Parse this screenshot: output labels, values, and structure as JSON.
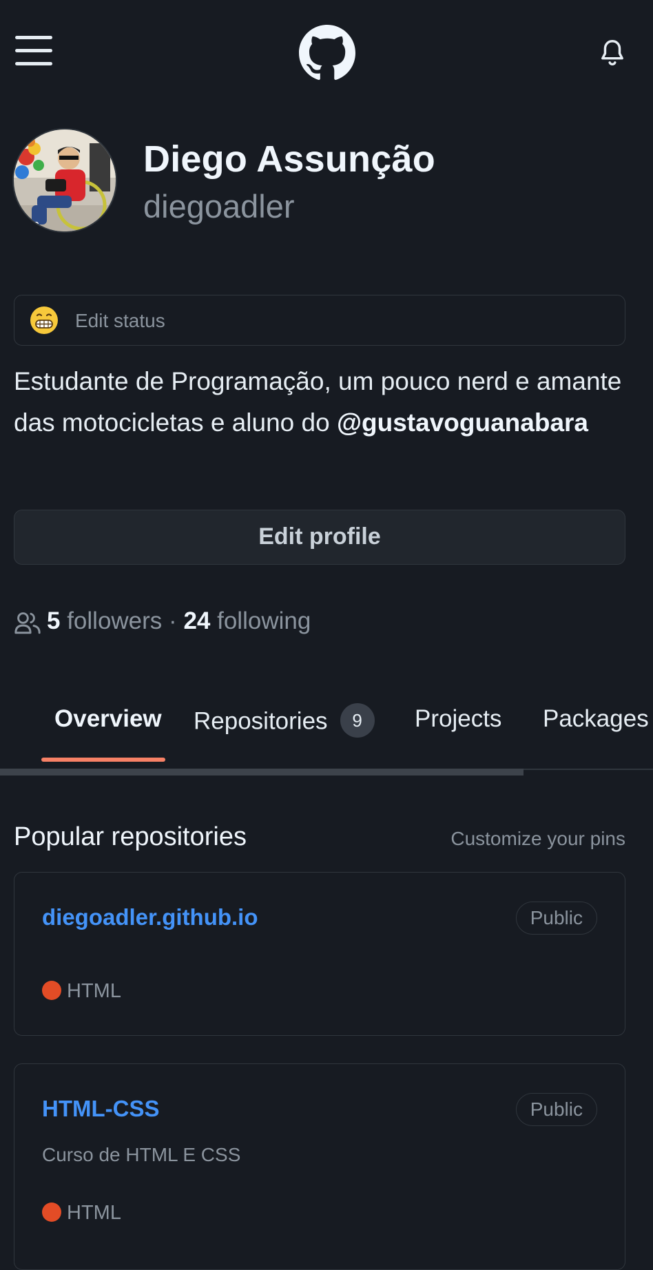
{
  "header": {
    "menu_icon": "hamburger-menu-icon",
    "logo_icon": "github-octocat-icon",
    "notifications_icon": "bell-icon"
  },
  "profile": {
    "name": "Diego Assunção",
    "login": "diegoadler",
    "status_emoji": "grinning-face-icon",
    "status_text": "Edit status",
    "bio_text": "Estudante de Programação, um pouco nerd e amante das motocicletas e aluno do ",
    "bio_mention": "@gustavoguanabara",
    "edit_profile_label": "Edit profile",
    "followers_count": "5",
    "followers_label": "followers",
    "separator": "·",
    "following_count": "24",
    "following_label": "following"
  },
  "tabs": [
    {
      "label": "Overview",
      "active": true
    },
    {
      "label": "Repositories",
      "counter": "9"
    },
    {
      "label": "Projects"
    },
    {
      "label": "Packages"
    }
  ],
  "popular": {
    "title": "Popular repositories",
    "customize_label": "Customize your pins",
    "repos": [
      {
        "name": "diegoadler.github.io",
        "visibility": "Public",
        "description": "",
        "language": "HTML"
      },
      {
        "name": "HTML-CSS",
        "visibility": "Public",
        "description": "Curso de HTML E CSS",
        "language": "HTML"
      }
    ]
  },
  "colors": {
    "background": "#171b22",
    "link": "#4493f8",
    "tab_underline": "#f78166",
    "html_language": "#e34c26"
  }
}
